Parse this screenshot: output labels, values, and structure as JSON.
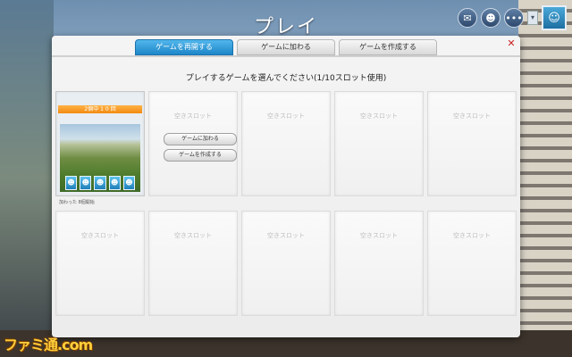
{
  "header": {
    "title": "プレイ",
    "icons": [
      "mail-icon",
      "friends-icon",
      "more-icon"
    ],
    "dropdown": "▾"
  },
  "tabs": [
    {
      "label": "ゲームを再開する",
      "active": true
    },
    {
      "label": "ゲームに加わる",
      "active": false
    },
    {
      "label": "ゲームを作成する",
      "active": false
    }
  ],
  "close": "✕",
  "prompt": "プレイするゲームを選んでください(1/10スロット使用)",
  "game_card": {
    "title": "",
    "badge": "2個中 1 0 回",
    "footer": "加わった 8個開始"
  },
  "slot_actions": {
    "join": "ゲームに加わる",
    "create": "ゲームを作成する"
  },
  "empty_slot_label": "空きスロット",
  "watermark": "ファミ通.com",
  "colors": {
    "active_tab": "#1d86c8",
    "badge": "#f28a10"
  }
}
